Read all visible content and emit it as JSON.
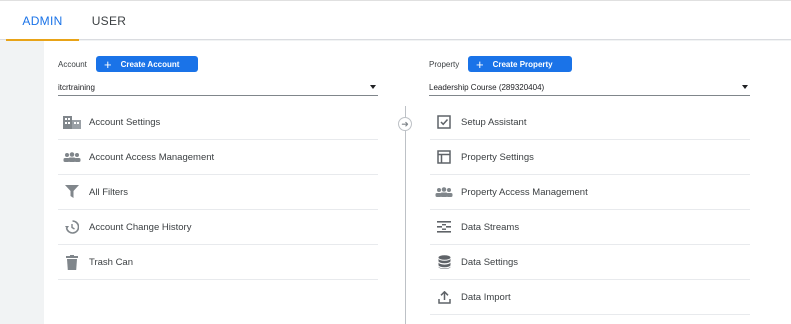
{
  "tabs": [
    {
      "label": "ADMIN",
      "active": true
    },
    {
      "label": "USER",
      "active": false
    }
  ],
  "account": {
    "label": "Account",
    "create_button": "Create Account",
    "selected": "itcrtraining",
    "items": [
      {
        "label": "Account Settings",
        "icon": "building-icon"
      },
      {
        "label": "Account Access Management",
        "icon": "people-icon"
      },
      {
        "label": "All Filters",
        "icon": "filter-icon"
      },
      {
        "label": "Account Change History",
        "icon": "history-icon"
      },
      {
        "label": "Trash Can",
        "icon": "trash-icon"
      }
    ]
  },
  "property": {
    "label": "Property",
    "create_button": "Create Property",
    "selected": "Leadership Course (289320404)",
    "items": [
      {
        "label": "Setup Assistant",
        "icon": "checkbox-icon"
      },
      {
        "label": "Property Settings",
        "icon": "layout-icon"
      },
      {
        "label": "Property Access Management",
        "icon": "people-icon"
      },
      {
        "label": "Data Streams",
        "icon": "streams-icon"
      },
      {
        "label": "Data Settings",
        "icon": "database-icon"
      },
      {
        "label": "Data Import",
        "icon": "upload-icon"
      }
    ]
  },
  "colors": {
    "accent": "#1a73e8",
    "tab_underline": "#e8a317",
    "icon": "#5f6368"
  }
}
